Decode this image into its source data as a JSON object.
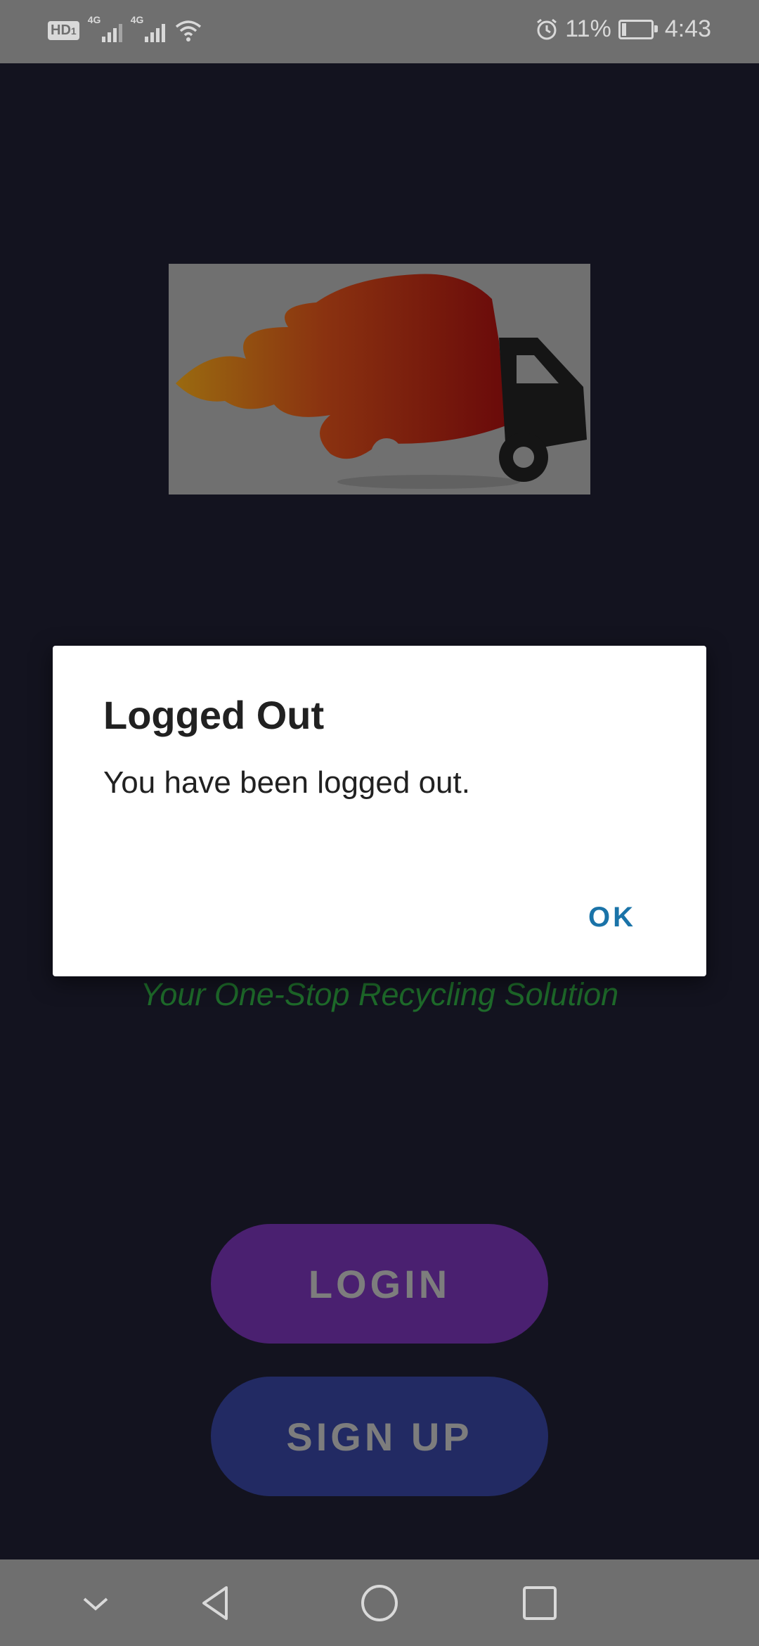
{
  "status_bar": {
    "hd_label": "HD",
    "sim_number": "1",
    "network_1": "4G",
    "network_2": "4G",
    "battery_percent": "11%",
    "time": "4:43"
  },
  "dialog": {
    "title": "Logged Out",
    "message": "You have been logged out.",
    "ok_label": "OK"
  },
  "main": {
    "tagline": "Your One-Stop Recycling Solution",
    "login_label": "LOGIN",
    "signup_label": "SIGN UP"
  },
  "icons": {
    "logo": "delivery-truck-flames-logo",
    "back": "back-triangle-icon",
    "home": "home-circle-icon",
    "recents": "recents-square-icon",
    "hide_nav": "chevron-down-icon"
  },
  "colors": {
    "background": "#13131f",
    "login_button": "#4a2070",
    "signup_button": "#222a63",
    "tagline": "#1e6a2a",
    "dialog_accent": "#1a73a8"
  }
}
